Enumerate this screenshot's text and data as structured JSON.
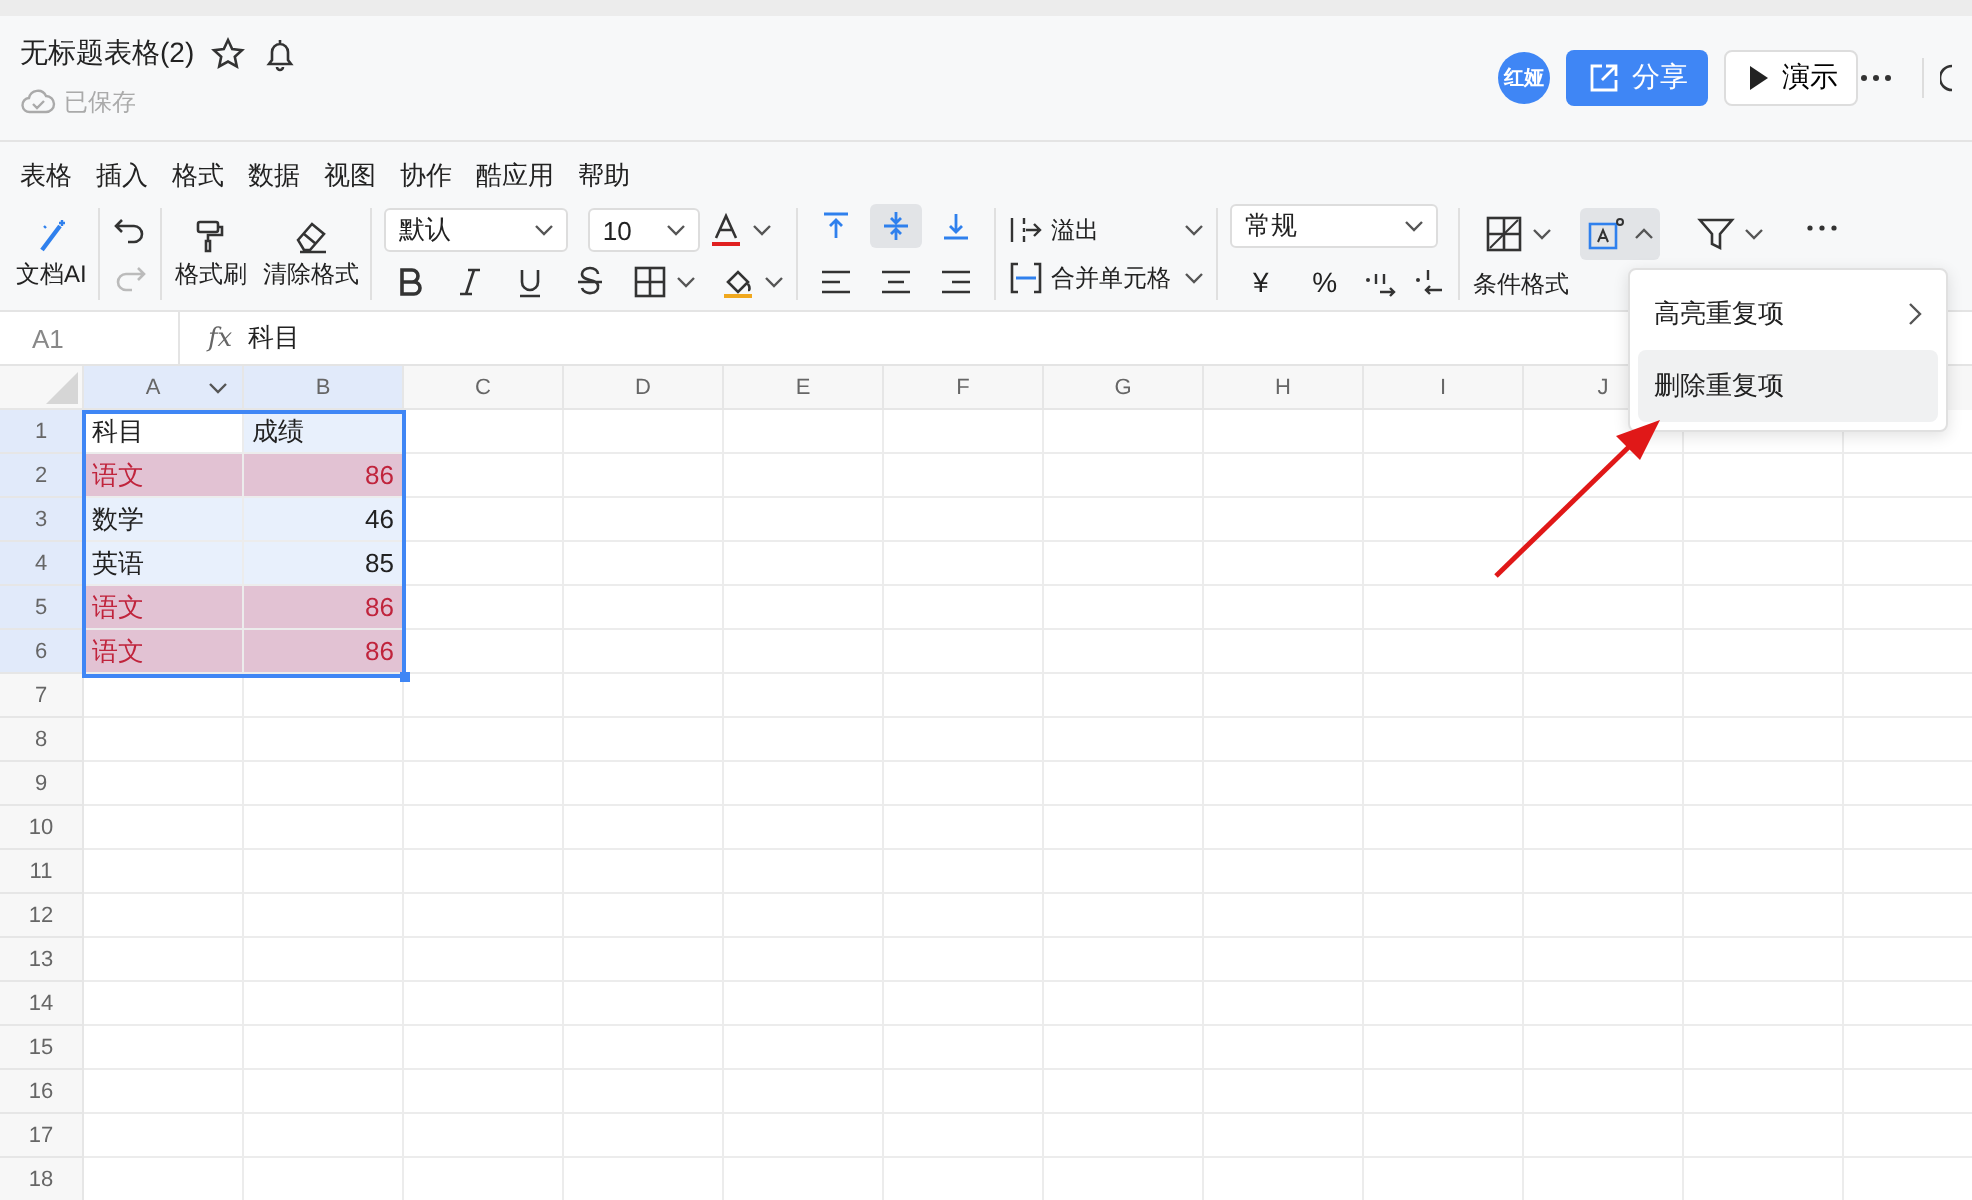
{
  "header": {
    "title": "无标题表格(2)",
    "saved": "已保存",
    "avatar": "红娅",
    "share": "分享",
    "present": "演示"
  },
  "menu": [
    "表格",
    "插入",
    "格式",
    "数据",
    "视图",
    "协作",
    "酷应用",
    "帮助"
  ],
  "toolbar": {
    "ai": "文档AI",
    "redo_disabled": true,
    "brush": "格式刷",
    "clear": "清除格式",
    "font": "默认",
    "size": "10",
    "valign": [
      {
        "kind": "top",
        "selected": false
      },
      {
        "kind": "middle",
        "selected": true
      },
      {
        "kind": "bottom",
        "selected": false
      }
    ],
    "overflow": "溢出",
    "merge": "合并单元格",
    "number_format": "常规",
    "currency": "¥",
    "percent": "%",
    "cond_format": "条件格式",
    "dup_open": true
  },
  "formula_bar": {
    "cell": "A1",
    "fx": "fx",
    "value": "科目"
  },
  "columns": [
    "A",
    "B",
    "C",
    "D",
    "E",
    "F",
    "G",
    "H",
    "I",
    "J"
  ],
  "rows": [
    {
      "n": "1",
      "a": "科目",
      "b": "成绩",
      "duplicate": false
    },
    {
      "n": "2",
      "a": "语文",
      "b": "86",
      "duplicate": true
    },
    {
      "n": "3",
      "a": "数学",
      "b": "46",
      "duplicate": false
    },
    {
      "n": "4",
      "a": "英语",
      "b": "85",
      "duplicate": false
    },
    {
      "n": "5",
      "a": "语文",
      "b": "86",
      "duplicate": true
    },
    {
      "n": "6",
      "a": "语文",
      "b": "86",
      "duplicate": true
    },
    {
      "n": "7"
    },
    {
      "n": "8"
    },
    {
      "n": "9"
    },
    {
      "n": "10"
    },
    {
      "n": "11"
    },
    {
      "n": "12"
    },
    {
      "n": "13"
    },
    {
      "n": "14"
    },
    {
      "n": "15"
    },
    {
      "n": "16"
    },
    {
      "n": "17"
    },
    {
      "n": "18"
    }
  ],
  "dropdown": [
    {
      "label": "高亮重复项",
      "submenu": true,
      "selected": false
    },
    {
      "label": "删除重复项",
      "submenu": false,
      "selected": true
    }
  ]
}
